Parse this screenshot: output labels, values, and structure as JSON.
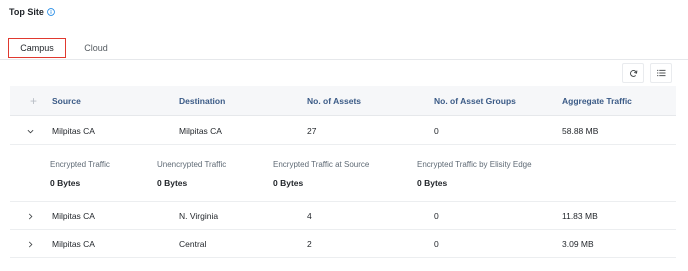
{
  "title": "Top Site",
  "tabs": [
    {
      "label": "Campus"
    },
    {
      "label": "Cloud"
    }
  ],
  "columns": [
    "Source",
    "Destination",
    "No. of Assets",
    "No. of Asset Groups",
    "Aggregate Traffic"
  ],
  "rows": [
    {
      "source": "Milpitas CA",
      "destination": "Milpitas CA",
      "assets": "27",
      "asset_groups": "0",
      "traffic": "58.88 MB",
      "expanded": true
    },
    {
      "source": "Milpitas CA",
      "destination": "N. Virginia",
      "assets": "4",
      "asset_groups": "0",
      "traffic": "11.83 MB",
      "expanded": false
    },
    {
      "source": "Milpitas CA",
      "destination": "Central",
      "assets": "2",
      "asset_groups": "0",
      "traffic": "3.09 MB",
      "expanded": false
    }
  ],
  "expanded_details": [
    {
      "label": "Encrypted Traffic",
      "value": "0 Bytes"
    },
    {
      "label": "Unencrypted Traffic",
      "value": "0 Bytes"
    },
    {
      "label": "Encrypted Traffic at Source",
      "value": "0 Bytes"
    },
    {
      "label": "Encrypted Traffic by Elisity Edge",
      "value": "0 Bytes"
    }
  ],
  "icons": {
    "info": "info-icon",
    "refresh": "refresh-icon",
    "columns": "list-icon",
    "add": "plus-icon",
    "expand": "chevron-right-icon",
    "collapse": "chevron-down-icon"
  },
  "colors": {
    "accent_blue": "#1e88e5",
    "header_text": "#3a5a86",
    "active_tab_border": "#e0392f"
  }
}
